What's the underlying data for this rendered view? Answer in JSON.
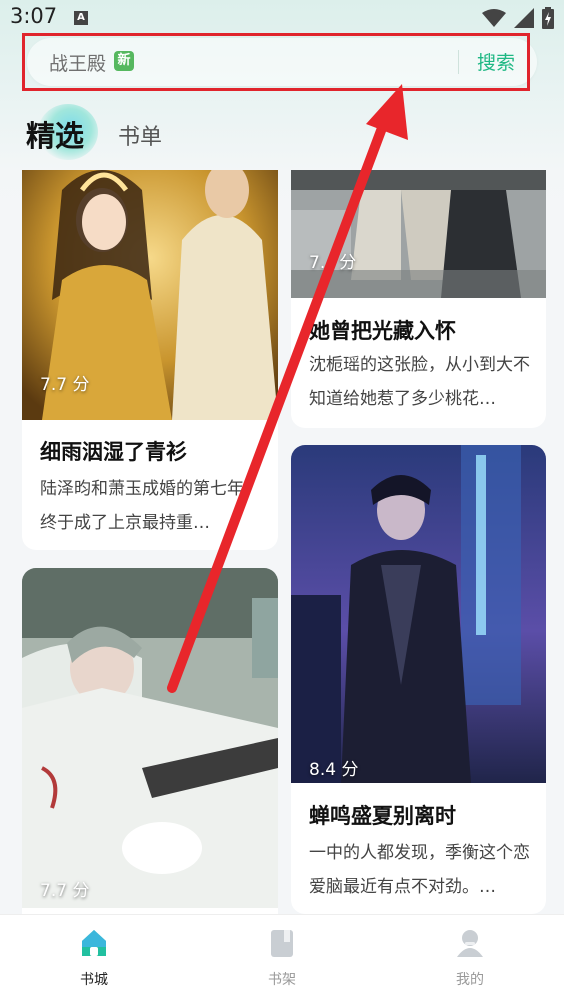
{
  "status_bar": {
    "time": "3:07",
    "notification_letter": "A"
  },
  "search": {
    "placeholder": "战王殿",
    "badge": "新",
    "button_label": "搜索"
  },
  "tabs": [
    {
      "label": "精选",
      "active": true
    },
    {
      "label": "书单",
      "active": false
    }
  ],
  "cards": [
    {
      "score": "7.7 分",
      "title": "细雨洇湿了青衫",
      "desc": "陆泽昀和萧玉成婚的第七年，终于成了上京最持重…"
    },
    {
      "score": "7.",
      "title": "她曾把光藏入怀",
      "desc": "沈栀瑶的这张脸，从小到大不知道给她惹了多少桃花…"
    },
    {
      "score": "8.4 分",
      "title": "蝉鸣盛夏别离时",
      "desc": "一中的人都发现，季衡这个恋爱脑最近有点不对劲。…"
    },
    {
      "score": "7.7 分",
      "title": "",
      "desc": ""
    }
  ],
  "score_suffix_partial": "分",
  "bottom_nav": [
    {
      "label": "书城",
      "icon": "home-icon",
      "active": true
    },
    {
      "label": "书架",
      "icon": "bookshelf-icon",
      "active": false
    },
    {
      "label": "我的",
      "icon": "profile-icon",
      "active": false
    }
  ],
  "colors": {
    "accent": "#1fb884",
    "highlight_frame": "#e0242c",
    "arrow": "#e8262b",
    "badge": "#56b85f"
  }
}
